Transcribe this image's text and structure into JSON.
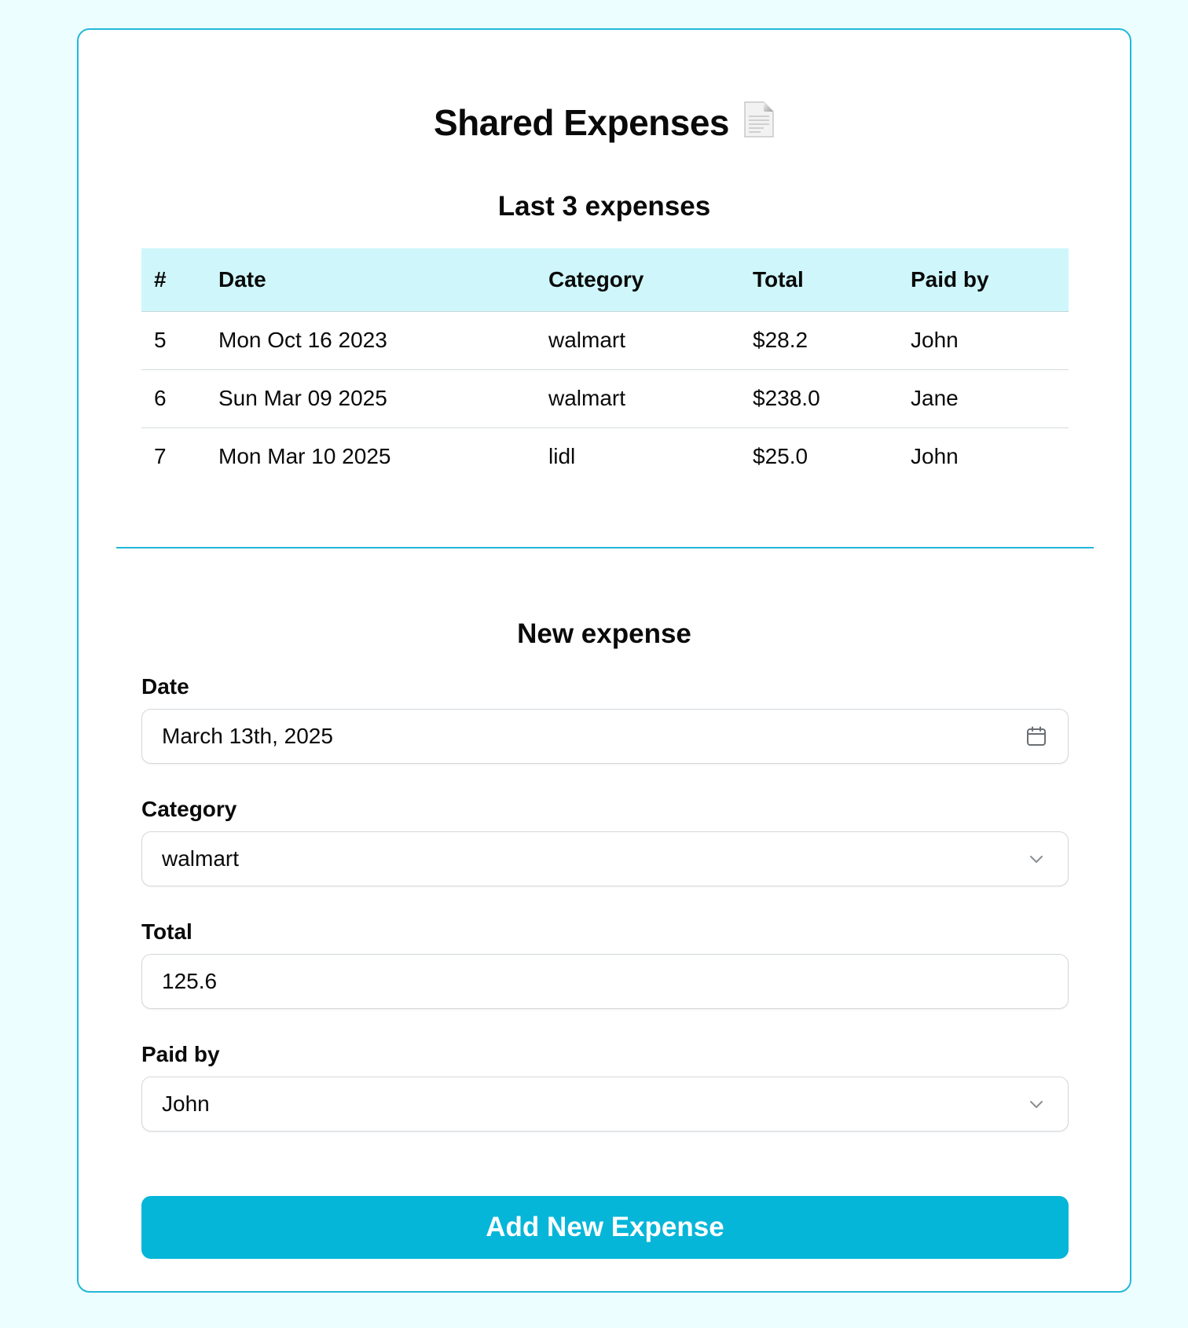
{
  "page": {
    "title": "Shared Expenses",
    "title_icon": "document-icon"
  },
  "last_expenses": {
    "heading": "Last 3 expenses",
    "columns": [
      "#",
      "Date",
      "Category",
      "Total",
      "Paid by"
    ],
    "rows": [
      [
        "5",
        "Mon Oct 16 2023",
        "walmart",
        "$28.2",
        "John"
      ],
      [
        "6",
        "Sun Mar 09 2025",
        "walmart",
        "$238.0",
        "Jane"
      ],
      [
        "7",
        "Mon Mar 10 2025",
        "lidl",
        "$25.0",
        "John"
      ]
    ]
  },
  "new_expense": {
    "heading": "New expense",
    "date": {
      "label": "Date",
      "value": "March 13th, 2025",
      "icon": "calendar-icon"
    },
    "category": {
      "label": "Category",
      "value": "walmart",
      "icon": "chevron-down-icon"
    },
    "total": {
      "label": "Total",
      "value": "125.6"
    },
    "paid_by": {
      "label": "Paid by",
      "value": "John",
      "icon": "chevron-down-icon"
    },
    "submit_label": "Add New Expense"
  },
  "colors": {
    "page_background": "#ecfeff",
    "accent": "#06b6d9",
    "border_accent": "#22b8d8",
    "table_header_bg": "#cff7fb"
  }
}
